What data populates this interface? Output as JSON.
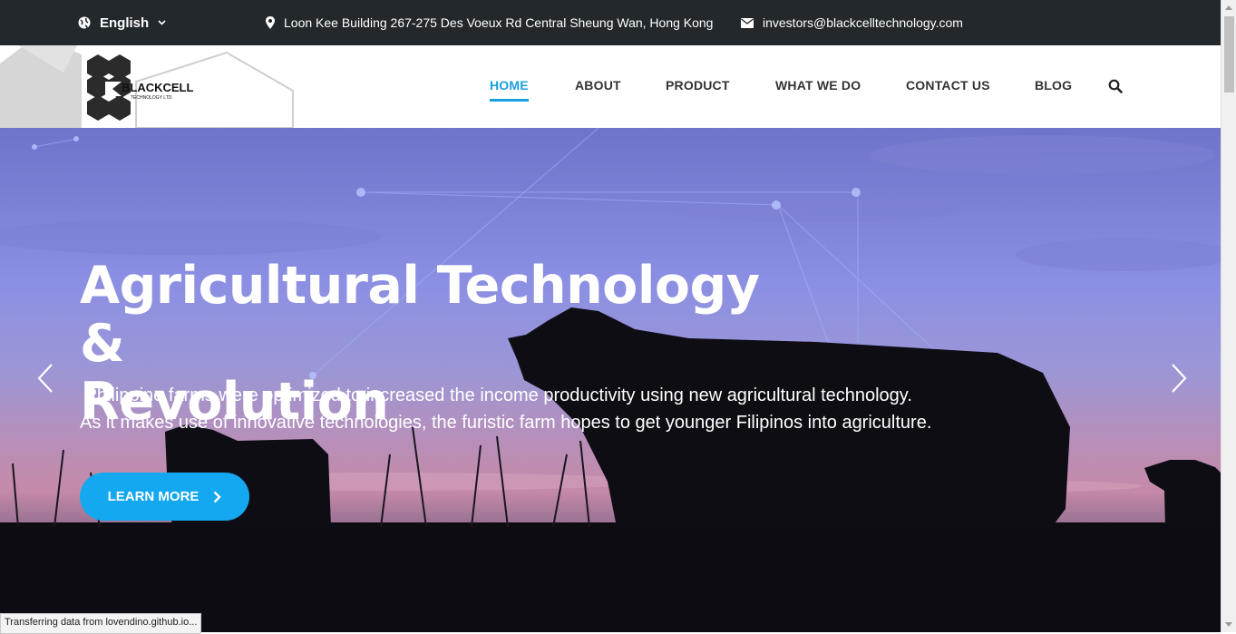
{
  "topbar": {
    "language": "English",
    "address": "Loon Kee Building 267-275 Des Voeux Rd Central Sheung Wan, Hong Kong",
    "email": "investors@blackcelltechnology.com"
  },
  "logo": {
    "name": "BLACKCELL",
    "sub": "TECHNOLOGY LTD."
  },
  "nav": {
    "items": [
      {
        "label": "HOME",
        "active": true
      },
      {
        "label": "ABOUT"
      },
      {
        "label": "PRODUCT"
      },
      {
        "label": "WHAT WE DO"
      },
      {
        "label": "CONTACT US"
      },
      {
        "label": "BLOG"
      }
    ],
    "search_icon": "search-icon"
  },
  "hero": {
    "title_line1": "Agricultural Technology &",
    "title_line2": "Revolution",
    "text_line1": "Philippine farms were optimized to increased the income productivity using new agricultural technology.",
    "text_line2": "As it makes use of innovative technologies, the furistic farm hopes to get younger Filipinos into agriculture.",
    "cta": "LEARN MORE"
  },
  "status_bar": "Transferring data from lovendino.github.io...",
  "colors": {
    "accent": "#14a8f0",
    "topbar": "#23282d",
    "nav_active": "#1a9fe0"
  }
}
